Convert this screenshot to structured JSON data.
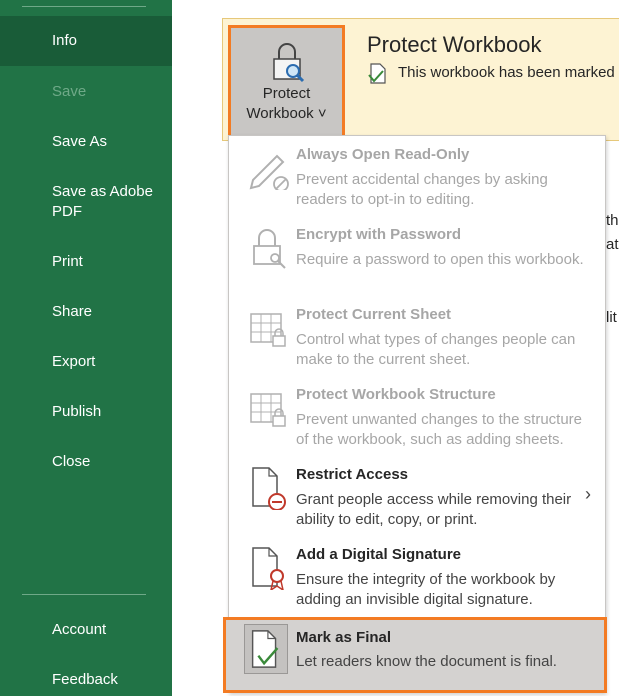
{
  "nav": {
    "items": [
      {
        "label": "Info",
        "state": "active"
      },
      {
        "label": "Save",
        "state": "disabled"
      },
      {
        "label": "Save As",
        "state": "normal"
      },
      {
        "label": "Save as Adobe PDF",
        "state": "normal"
      },
      {
        "label": "Print",
        "state": "normal"
      },
      {
        "label": "Share",
        "state": "normal"
      },
      {
        "label": "Export",
        "state": "normal"
      },
      {
        "label": "Publish",
        "state": "normal"
      },
      {
        "label": "Close",
        "state": "normal"
      }
    ],
    "bottom_items": [
      {
        "label": "Account"
      },
      {
        "label": "Feedback"
      }
    ]
  },
  "protect": {
    "button_line1": "Protect",
    "button_line2": "Workbook ˅",
    "title": "Protect Workbook",
    "subtitle": "This workbook has been marked a"
  },
  "edge_text": [
    "th",
    "ath",
    "lit"
  ],
  "menu": {
    "items": [
      {
        "title": "Always Open Read-Only",
        "desc": "Prevent accidental changes by asking readers to opt-in to editing.",
        "enabled": false,
        "icon": "pencil-icon"
      },
      {
        "title": "Encrypt with Password",
        "desc": "Require a password to open this workbook.",
        "enabled": false,
        "icon": "lock-key-icon"
      },
      {
        "title": "Protect Current Sheet",
        "desc": "Control what types of changes people can make to the current sheet.",
        "enabled": false,
        "icon": "sheet-lock-icon"
      },
      {
        "title": "Protect Workbook Structure",
        "desc": "Prevent unwanted changes to the structure of the workbook, such as adding sheets.",
        "enabled": false,
        "icon": "workbook-lock-icon"
      },
      {
        "title": "Restrict Access",
        "desc": "Grant people access while removing their ability to edit, copy, or print.",
        "enabled": true,
        "icon": "restrict-access-icon",
        "submenu": "›"
      },
      {
        "title": "Add a Digital Signature",
        "desc": "Ensure the integrity of the workbook by adding an invisible digital signature.",
        "enabled": true,
        "icon": "digital-signature-icon"
      }
    ],
    "mark_final": {
      "title": "Mark as Final",
      "desc": "Let readers know the document is final.",
      "icon": "mark-final-icon"
    }
  },
  "colors": {
    "sidebar": "#217346",
    "sidebar_active": "#195c38",
    "highlight": "#f37b23",
    "panel_bg": "#fdf3d3"
  }
}
